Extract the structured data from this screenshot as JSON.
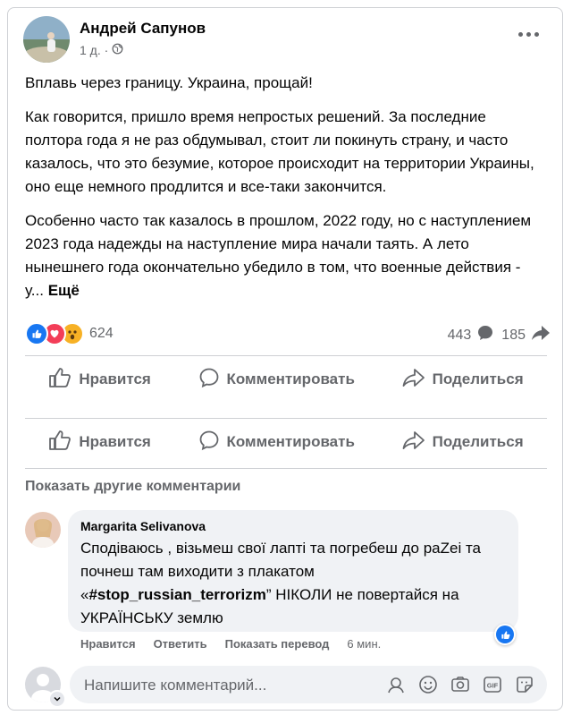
{
  "post": {
    "author": "Андрей Сапунов",
    "time": "1 д. ·",
    "paragraphs": [
      "Вплавь через границу. Украина, прощай!",
      "Как говорится, пришло время непростых решений. За последние полтора года я не раз обдумывал, стоит ли покинуть страну, и часто казалось, что это безумие, которое происходит на территории Украины, оно еще немного продлится и все-таки закончится.",
      "Особенно часто так казалось в прошлом, 2022 году, но с наступлением 2023 года надежды на наступление мира начали таять. А лето нынешнего года окончательно убедило в том, что военные действия - у..."
    ],
    "see_more": "Ещё",
    "reactions_count": "624",
    "comments_count": "443",
    "shares_count": "185"
  },
  "actions": {
    "like": "Нравится",
    "comment": "Комментировать",
    "share": "Поделиться"
  },
  "show_more_comments": "Показать другие комментарии",
  "comment": {
    "author": "Margarita Selivanova",
    "text_before": "Сподіваюсь , візьмеш свої лапті та погребеш до раZеі та почнеш там виходити з плакатом «",
    "hashtag": "#stop_russian_terrorizm",
    "text_after": "” НІКОЛИ не повертайся на УКРАЇНСЬКУ землю",
    "like": "Нравится",
    "reply": "Ответить",
    "translate": "Показать перевод",
    "time": "6 мин."
  },
  "composer": {
    "placeholder": "Напишите комментарий..."
  },
  "colors": {
    "like_blue": "#1877f2",
    "love_red": "#f33e58",
    "wow_yellow": "#f7b125",
    "secondary_text": "#65676b"
  }
}
